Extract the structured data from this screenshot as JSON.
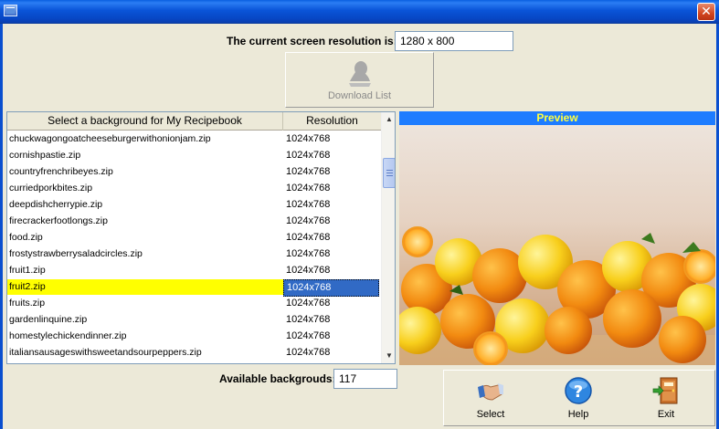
{
  "window": {
    "title": ""
  },
  "resolution": {
    "label": "The current screen resolution is:",
    "value": "1280 x 800"
  },
  "download": {
    "label": "Download List"
  },
  "list": {
    "header_name": "Select a background for My Recipebook",
    "header_resolution": "Resolution",
    "rows": [
      {
        "name": "chuckwagongoatcheeseburgerwithonionjam.zip",
        "res": "1024x768"
      },
      {
        "name": "cornishpastie.zip",
        "res": "1024x768"
      },
      {
        "name": "countryfrenchribeyes.zip",
        "res": "1024x768"
      },
      {
        "name": "curriedporkbites.zip",
        "res": "1024x768"
      },
      {
        "name": "deepdishcherrypie.zip",
        "res": "1024x768"
      },
      {
        "name": "firecrackerfootlongs.zip",
        "res": "1024x768"
      },
      {
        "name": "food.zip",
        "res": "1024x768"
      },
      {
        "name": "frostystrawberrysaladcircles.zip",
        "res": "1024x768"
      },
      {
        "name": "fruit1.zip",
        "res": "1024x768"
      },
      {
        "name": "fruit2.zip",
        "res": "1024x768",
        "selected": true
      },
      {
        "name": "fruits.zip",
        "res": "1024x768"
      },
      {
        "name": "gardenlinquine.zip",
        "res": "1024x768"
      },
      {
        "name": "homestylechickendinner.zip",
        "res": "1024x768"
      },
      {
        "name": "italiansausageswithsweetandsourpeppers.zip",
        "res": "1024x768"
      }
    ]
  },
  "preview": {
    "title": "Preview"
  },
  "available": {
    "label": "Available backgrouds:",
    "value": "117"
  },
  "toolbar": {
    "select_label": "Select",
    "help_label": "Help",
    "exit_label": "Exit"
  },
  "icons": {
    "app": "app-window-icon",
    "close": "close-icon",
    "download": "download-person-icon",
    "select": "handshake-icon",
    "help": "question-mark-icon",
    "exit": "exit-door-icon"
  },
  "colors": {
    "titlebar": "#0a55d8",
    "preview_header": "#1e7cff",
    "preview_header_text": "#ffff40",
    "selected_row": "#ffff00",
    "selected_cell": "#316ac5"
  }
}
